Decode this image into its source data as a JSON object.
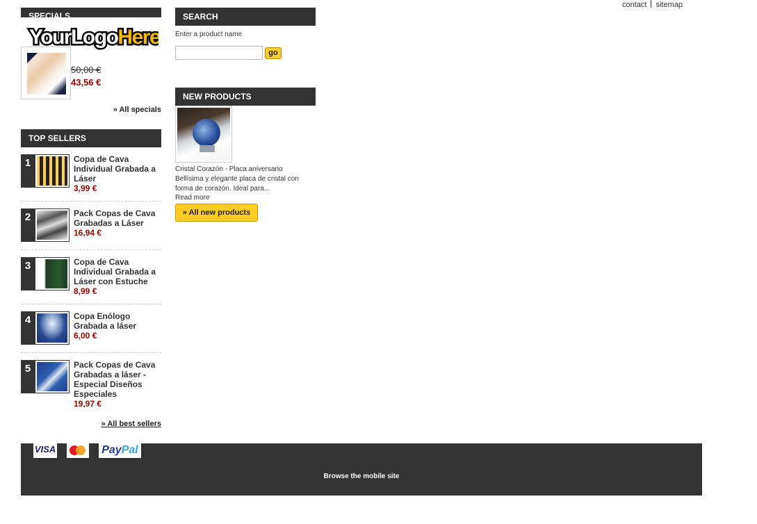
{
  "header": {
    "links": [
      "contact",
      "sitemap"
    ]
  },
  "specials": {
    "title": "Specials",
    "logo_text": "YourLogoHere",
    "old_price": "50,00 €",
    "new_price": "43,56 €",
    "all_link": "» All specials"
  },
  "top_sellers": {
    "title": "Top Sellers",
    "items": [
      {
        "rank": "1",
        "name": "Copa de Cava Individual Grabada a Láser",
        "price": "3,99 €"
      },
      {
        "rank": "2",
        "name": "Pack Copas de Cava Grabadas a Láser",
        "price": "16,94 €"
      },
      {
        "rank": "3",
        "name": "Copa de Cava Individual Grabada a Láser con Estuche",
        "price": "8,99 €"
      },
      {
        "rank": "4",
        "name": "Copa Enólogo Grabada a láser",
        "price": "6,00 €"
      },
      {
        "rank": "5",
        "name": "Pack Copas de Cava Grabadas a láser - Especial Diseños Especiales",
        "price": "19,97 €"
      }
    ],
    "all_link": "» All best sellers"
  },
  "search": {
    "title": "Search",
    "label": "Enter a product name",
    "value": "",
    "go_label": "go"
  },
  "new_products": {
    "title": "New products",
    "product_name": "Cristal Corazón - Placa aniversario",
    "description": "Bellísima y elegante placa de cristal con forma de corazón. Ideal para...",
    "read_more": "Read more",
    "all_button": "» All new products"
  },
  "footer": {
    "payments": {
      "visa": "VISA",
      "mastercard": "MasterCard",
      "paypal_a": "Pay",
      "paypal_b": "Pal"
    },
    "mobile_link": "Browse the mobile site"
  },
  "colors": {
    "dark_bar": "#333333",
    "price_red": "#990000",
    "button_yellow": "#ffcc22"
  }
}
